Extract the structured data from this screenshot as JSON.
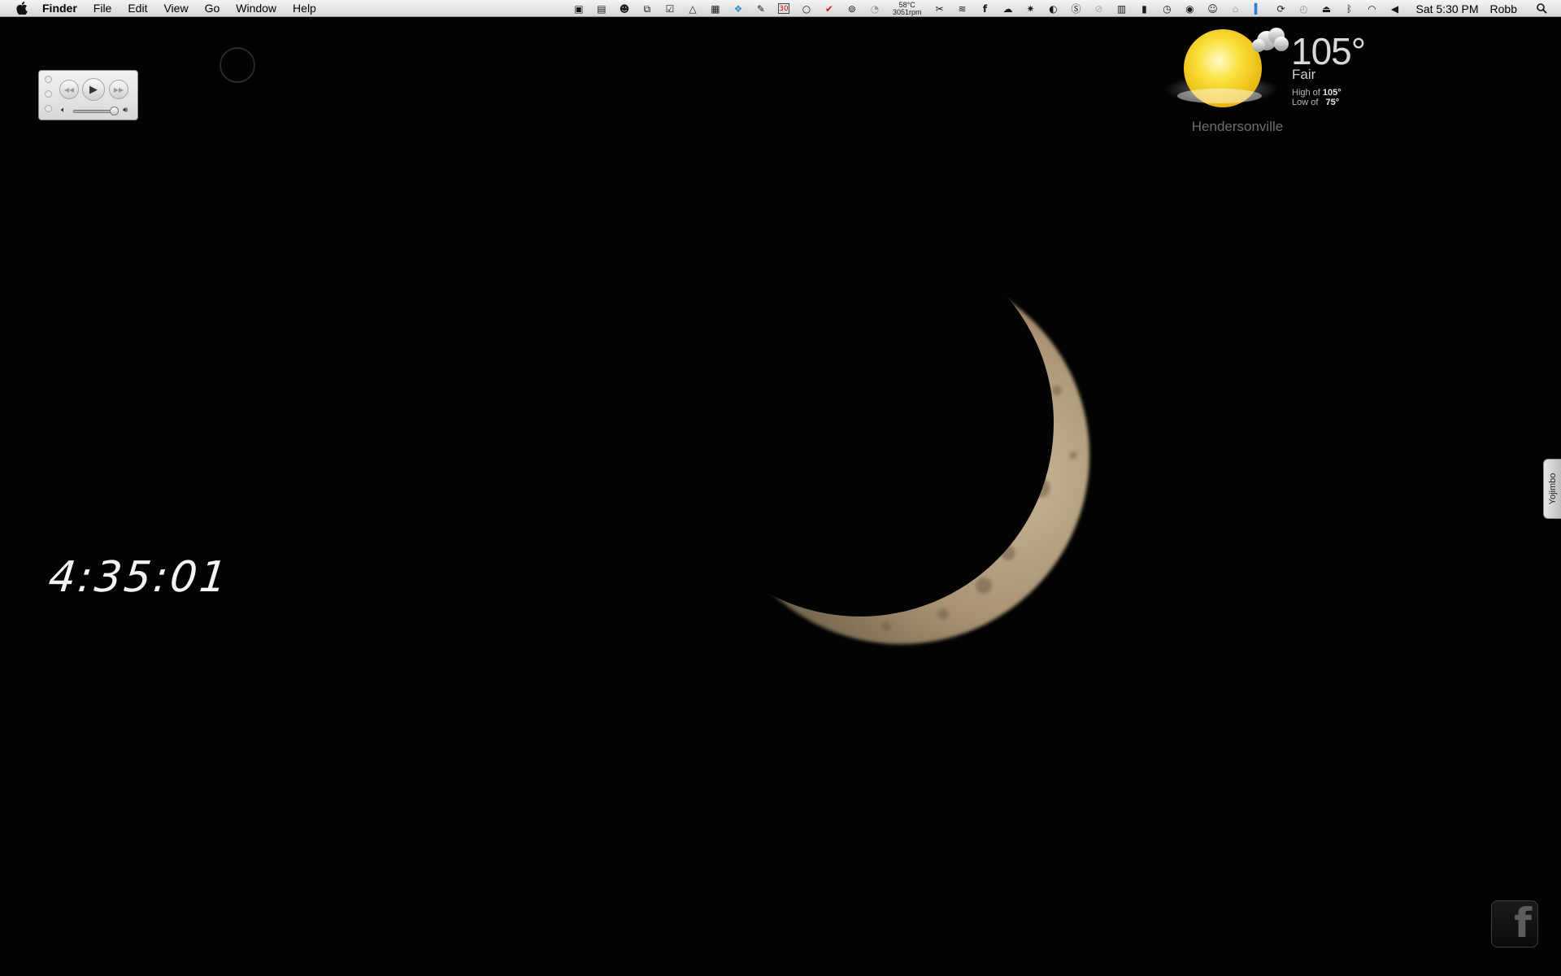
{
  "menubar": {
    "apple_icon": "apple-logo-icon",
    "app_name": "Finder",
    "menus": [
      "File",
      "Edit",
      "View",
      "Go",
      "Window",
      "Help"
    ],
    "status_icons": [
      "dropbox-icon",
      "terminal-icon",
      "monkey-icon",
      "clipboard-icon",
      "checklist-icon",
      "drive-icon",
      "grid-icon",
      "globe-icon",
      "notes-icon",
      "calendar-icon",
      "circle-icon",
      "checkmark-icon",
      "cloud-app-icon",
      "signal-icon",
      "scissors-icon",
      "wifi-manager-icon",
      "facebook-icon",
      "cloud-icon",
      "brightness-icon",
      "caffeine-icon",
      "skype-icon",
      "block-icon",
      "calculator-icon",
      "bookmark-icon",
      "clock-icon",
      "eye-icon",
      "smiley-icon",
      "house-icon",
      "battery-icon",
      "sync-icon",
      "time-machine-icon",
      "eject-icon",
      "bluetooth-icon",
      "wifi-icon",
      "volume-icon",
      "spotlight-icon"
    ],
    "calendar_day": "30",
    "cpu_temp": "58°C",
    "fan_speed": "3051rpm",
    "clock": "Sat 5:30 PM",
    "user": "Robb"
  },
  "itunes": {
    "prev_icon": "rewind-icon",
    "play_icon": "play-icon",
    "next_icon": "fast-forward-icon",
    "volume_level": 0.92
  },
  "weather": {
    "temp": "105°",
    "condition": "Fair",
    "high_label": "High of",
    "high_value": "105°",
    "low_label": "Low of",
    "low_value": "75°",
    "city": "Hendersonville",
    "icon": "sun-with-cloud-icon"
  },
  "clock_widget": {
    "time": "4:35:01"
  },
  "yojimbo": {
    "label": "Yojimbo"
  },
  "facebook": {
    "glyph": "f"
  },
  "colors": {
    "background": "#030303",
    "moon": "#b9a585",
    "sun": "#f7d31c"
  }
}
